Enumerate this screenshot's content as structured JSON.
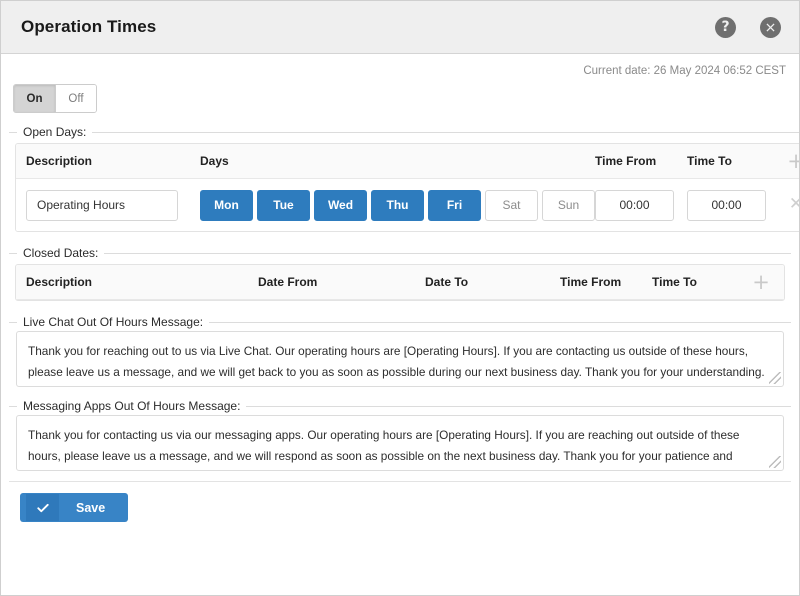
{
  "window": {
    "title": "Operation Times",
    "help_icon": "help-circle-icon",
    "close_icon": "close-circle-icon"
  },
  "header": {
    "current_date": "Current date: 26 May 2024 06:52 CEST"
  },
  "status_toggle": {
    "on_label": "On",
    "off_label": "Off",
    "selected": "On"
  },
  "open_days": {
    "legend": "Open Days:",
    "columns": {
      "description": "Description",
      "days": "Days",
      "time_from": "Time From",
      "time_to": "Time To",
      "add_icon": "plus-icon"
    },
    "row": {
      "description_value": "Operating Hours",
      "description_placeholder": "",
      "days": [
        {
          "label": "Mon",
          "selected": true
        },
        {
          "label": "Tue",
          "selected": true
        },
        {
          "label": "Wed",
          "selected": true
        },
        {
          "label": "Thu",
          "selected": true
        },
        {
          "label": "Fri",
          "selected": true
        },
        {
          "label": "Sat",
          "selected": false
        },
        {
          "label": "Sun",
          "selected": false
        }
      ],
      "time_from_value": "00:00",
      "time_to_value": "00:00",
      "delete_icon": "times-icon"
    }
  },
  "closed_dates": {
    "legend": "Closed Dates:",
    "columns": {
      "description": "Description",
      "date_from": "Date From",
      "date_to": "Date To",
      "time_from": "Time From",
      "time_to": "Time To",
      "add_icon": "plus-icon"
    },
    "rows": []
  },
  "live_chat_message": {
    "legend": "Live Chat Out Of Hours Message:",
    "value": "Thank you for reaching out to us via Live Chat. Our operating hours are [Operating Hours]. If you are contacting us outside of these hours, please leave us a message, and we will get back to you as soon as possible during our next business day. Thank you for your understanding."
  },
  "messaging_apps_message": {
    "legend": "Messaging Apps Out Of Hours Message:",
    "value": "Thank you for contacting us via our messaging apps. Our operating hours are [Operating Hours]. If you are reaching out outside of these hours, please leave us a message, and we will respond as soon as possible on the next business day. Thank you for your patience and understanding."
  },
  "footer": {
    "save_label": "Save",
    "save_icon": "check-icon"
  },
  "colors": {
    "accent_blue": "#2e7cbe",
    "save_blue": "#3884c6",
    "titlebar_bg": "#efefef",
    "icon_gray": "#6f6f6f",
    "muted_text": "#8a8a8a"
  }
}
